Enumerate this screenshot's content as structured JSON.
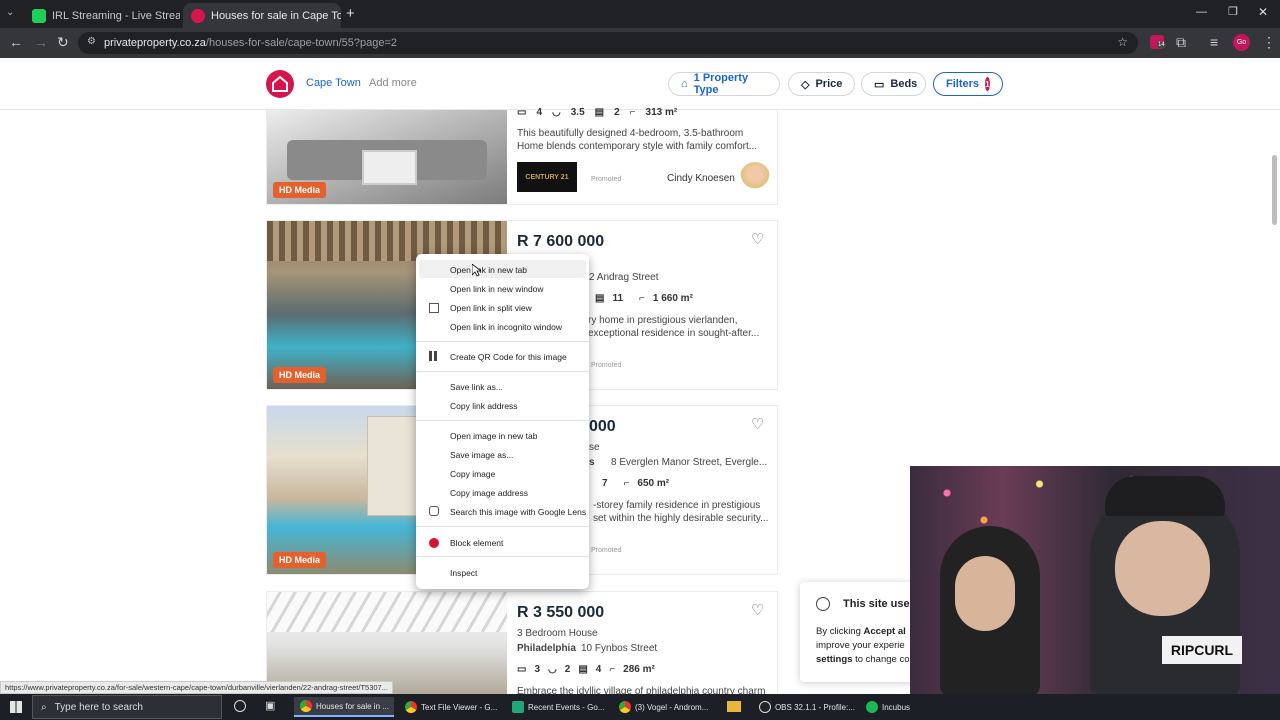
{
  "browser": {
    "tabs": [
      {
        "title": "IRL Streaming - Live Streams on",
        "fav_color": "#1fcf5a"
      },
      {
        "title": "Houses for sale in Cape Town |",
        "fav_color": "#d6154c"
      }
    ],
    "url_host": "privateproperty.co.za",
    "url_path": "/houses-for-sale/cape-town/55?page=2",
    "profile": "Go",
    "ext_badge": "14"
  },
  "site_header": {
    "location": "Cape Town",
    "add_more": "Add more",
    "filters": [
      {
        "label": "1 Property Type",
        "icon": "house-icon"
      },
      {
        "label": "Price",
        "icon": "tag-icon"
      },
      {
        "label": "Beds",
        "icon": "bed-icon"
      }
    ],
    "filters_button": "Filters",
    "filters_count": "1"
  },
  "listings": [
    {
      "beds": "4",
      "baths": "3.5",
      "garages": "2",
      "size": "313 m²",
      "desc1": "This beautifully designed 4-bedroom, 3.5-bathroom",
      "desc2": "Home blends contemporary style with family comfort...",
      "agency": "CENTURY 21",
      "promo": "Promoted",
      "agent": "Cindy Knoesen",
      "hd": "HD Media"
    },
    {
      "price": "R 7 600 000",
      "type": "se",
      "address": "2 Andrag Street",
      "garages": "11",
      "size": "1 660 m²",
      "desc1": "ry home in prestigious vierlanden,",
      "desc2": "exceptional residence in sought-after...",
      "promo": "Promoted",
      "hd": "HD Media"
    },
    {
      "price": "000",
      "type": "se",
      "suburb": "s",
      "address": "8 Everglen Manor Street, Evergle...",
      "garages": "7",
      "size": "650 m²",
      "desc1": "-storey family residence in prestigious",
      "desc2": "set within the highly desirable security...",
      "promo": "Promoted",
      "hd": "HD Media"
    },
    {
      "price": "R 3 550 000",
      "type": "3 Bedroom House",
      "suburb": "Philadelphia",
      "address": "10 Fynbos Street",
      "beds": "3",
      "baths": "2",
      "garages": "4",
      "size": "286 m²",
      "desc1": "Embrace the idyllic village of philadelphia country charm"
    }
  ],
  "context_menu": {
    "items": [
      "Open link in new tab",
      "Open link in new window",
      "Open link in split view",
      "Open link in incognito window",
      "Create QR Code for this image",
      "Save link as...",
      "Copy link address",
      "Open image in new tab",
      "Save image as...",
      "Copy image",
      "Copy image address",
      "Search this image with Google Lens",
      "Block element",
      "Inspect"
    ]
  },
  "cookie": {
    "title": "This site use",
    "line1_pre": "By clicking ",
    "line1_bold": "Accept al",
    "line2": "improve your experie",
    "line3_bold": "settings",
    "line3": " to change co"
  },
  "webcam": {
    "cap_text": "RIPCURL"
  },
  "status_url": "https://www.privateproperty.co.za/for-sale/western-cape/cape-town/durbanville/vierlanden/22-andrag-street/T5307...",
  "taskbar": {
    "search_placeholder": "Type here to search",
    "items": [
      "Houses for sale in ...",
      "Text File Viewer - G...",
      "Recent Events - Go...",
      "(3) Vogel - Androm...",
      "OBS 32.1.1 - Profile:...",
      "Incubus"
    ]
  }
}
